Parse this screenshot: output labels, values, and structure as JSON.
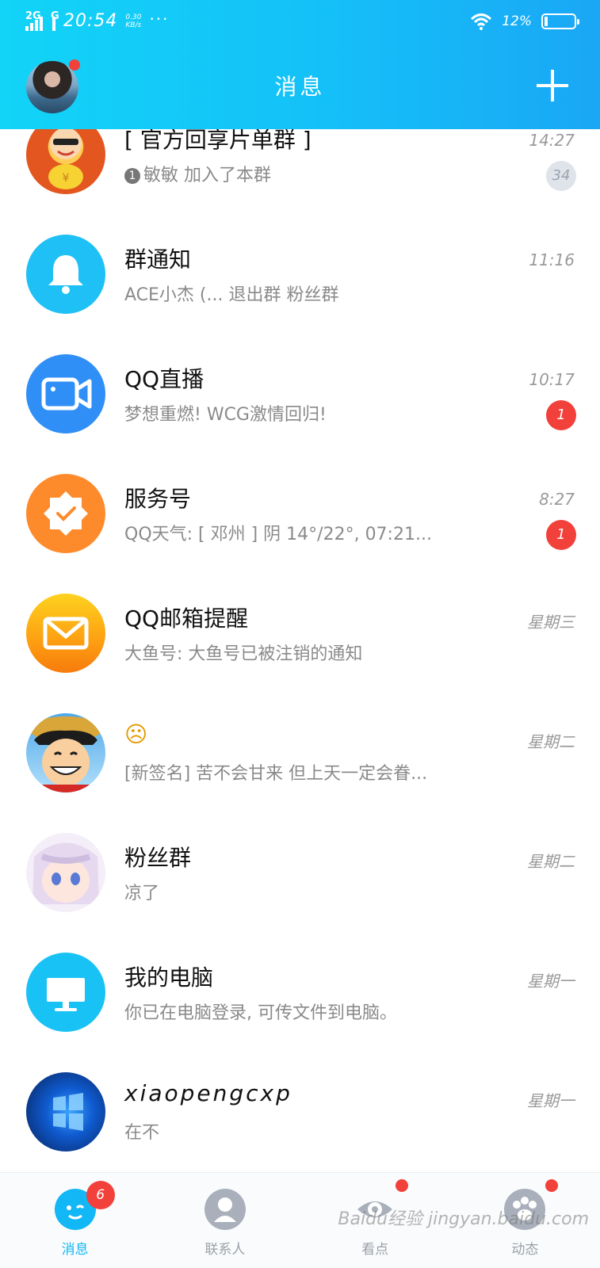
{
  "status_bar": {
    "network": "2G",
    "network2": "G",
    "time": "20:54",
    "speed_value": "0.30",
    "speed_unit": "KB/s",
    "more": "···",
    "battery": "12%"
  },
  "header": {
    "title": "消息",
    "add_label": "+"
  },
  "conversations": [
    {
      "name": "[ 官方回享片单群 ]",
      "preview_count": "1",
      "preview": "敏敏 加入了本群",
      "time": "14:27",
      "badge": "34",
      "badge_style": "muted",
      "icon": "group-cartoon-avatar"
    },
    {
      "name": "群通知",
      "preview": "ACE小杰 (... 退出群 粉丝群",
      "time": "11:16",
      "badge": "",
      "icon": "bell-icon"
    },
    {
      "name": "QQ直播",
      "preview": "梦想重燃! WCG激情回归!",
      "time": "10:17",
      "badge": "1",
      "icon": "video-camera-icon"
    },
    {
      "name": "服务号",
      "preview": "QQ天气: [ 邓州 ] 阴 14°/22°, 07:21...",
      "time": "8:27",
      "badge": "1",
      "icon": "badge-check-icon"
    },
    {
      "name": "QQ邮箱提醒",
      "preview": "大鱼号: 大鱼号已被注销的通知",
      "time": "星期三",
      "badge": "",
      "icon": "mail-icon"
    },
    {
      "name": "☹",
      "preview": "[新签名] 苦不会甘来 但上天一定会眷...",
      "time": "星期二",
      "badge": "",
      "icon": "anime-avatar"
    },
    {
      "name": "粉丝群",
      "preview": "凉了",
      "time": "星期二",
      "badge": "",
      "icon": "anime-girl-avatar"
    },
    {
      "name": "我的电脑",
      "preview": "你已在电脑登录, 可传文件到电脑。",
      "time": "星期一",
      "badge": "",
      "icon": "monitor-icon"
    },
    {
      "name": "xiaopengcxp",
      "preview": "在不",
      "time": "星期一",
      "badge": "",
      "icon": "windows-avatar"
    }
  ],
  "bottom_nav": [
    {
      "label": "消息",
      "badge": "6",
      "active": true
    },
    {
      "label": "联系人",
      "badge": "",
      "active": false
    },
    {
      "label": "看点",
      "badge": "",
      "dot": true,
      "active": false
    },
    {
      "label": "动态",
      "badge": "",
      "dot": true,
      "active": false
    }
  ],
  "watermark": "Baidu经验 jingyan.baidu.com"
}
